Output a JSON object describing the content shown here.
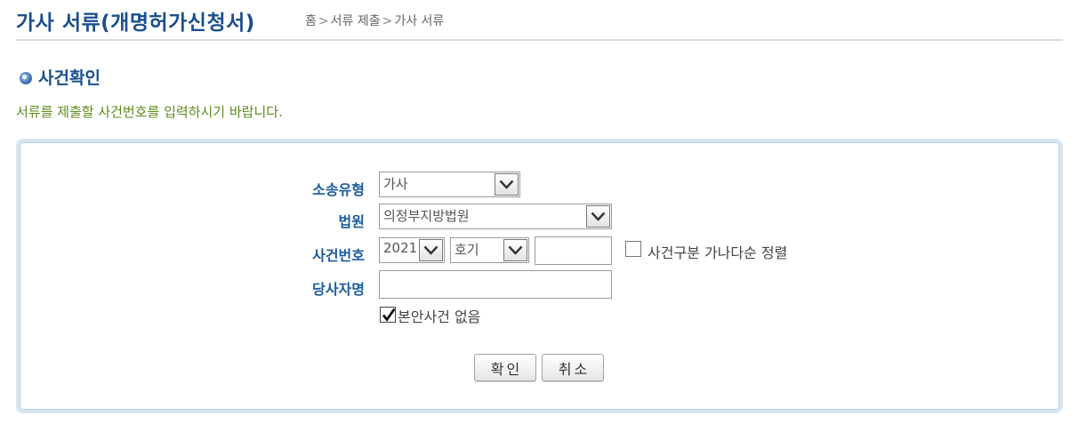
{
  "header": {
    "title": "가사 서류(개명허가신청서)",
    "breadcrumb": [
      "홈",
      "서류 제출",
      "가사 서류"
    ],
    "breadcrumb_sep": ">"
  },
  "section": {
    "title": "사건확인",
    "instruction": "서류를 제출할 사건번호를 입력하시기 바랍니다."
  },
  "form": {
    "litigation_type_label": "소송유형",
    "litigation_type_value": "가사",
    "court_label": "법원",
    "court_value": "의정부지방법원",
    "case_number_label": "사건번호",
    "year_value": "2021",
    "case_kind_value": "호기",
    "case_serial_value": "",
    "sort_checkbox_label": "사건구분 가나다순 정렬",
    "sort_checked": false,
    "party_name_label": "당사자명",
    "party_name_value": "",
    "no_own_case_label": "본안사건 없음",
    "no_own_case_checked": true,
    "confirm_button": "확인",
    "cancel_button": "취소"
  },
  "colors": {
    "title": "#1b4f8c",
    "label": "#1b5c9e",
    "instruction": "#5f8a1e",
    "panel_border": "#d8e6f1"
  }
}
